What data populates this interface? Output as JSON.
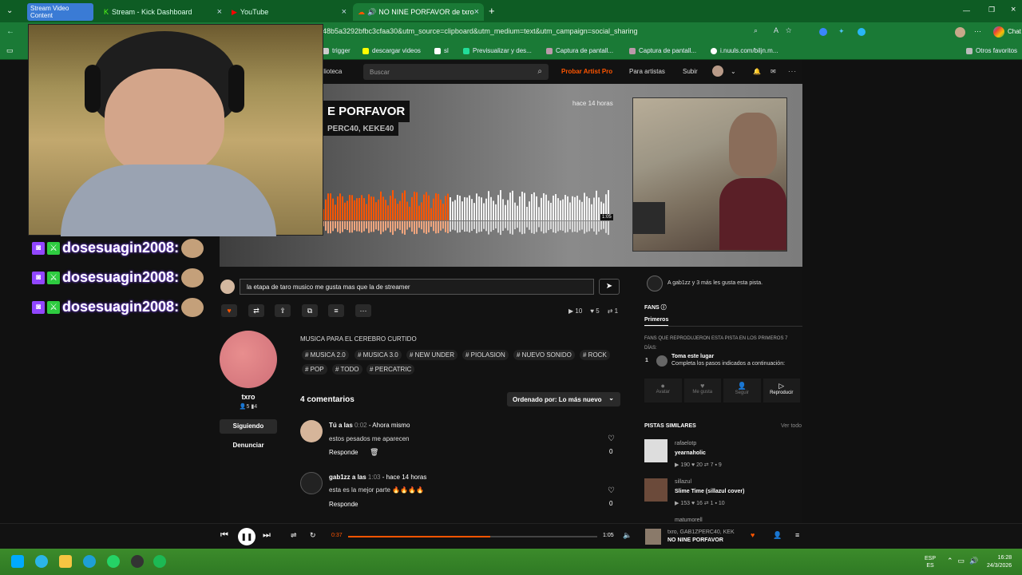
{
  "browser": {
    "tabs": [
      {
        "label": "Stream Video Content",
        "kind": "pill"
      },
      {
        "label": "Stream - Kick Dashboard"
      },
      {
        "label": "YouTube"
      },
      {
        "label": "NO NINE PORFAVOR de txro",
        "active": true
      }
    ],
    "url": "48b5a3292bfbc3cfaa30&utm_source=clipboard&utm_medium=text&utm_campaign=social_sharing",
    "bookmarks": [
      "trigger",
      "descargar videos",
      "sl",
      "Previsualizar y des...",
      "Captura de pantall...",
      "Captura de pantall...",
      "i.nuuls.com/biljn.m..."
    ],
    "other_bookmarks": "Otros favoritos",
    "profile_label": "Chat"
  },
  "header": {
    "library": "iblioteca",
    "search_placeholder": "Buscar",
    "try_pro": "Probar Artist Pro",
    "for_artists": "Para artistas",
    "upload": "Subir"
  },
  "hero": {
    "title": "E PORFAVOR",
    "artists": "PERC40, KEKE40",
    "time_ago": "hace 14 horas",
    "waveform_marker": "1:05"
  },
  "chat": {
    "lines": [
      "dosesuagin2008:",
      "dosesuagin2008:",
      "dosesuagin2008:"
    ]
  },
  "comment_input": {
    "value": "la etapa de taro musico me gusta mas que la de streamer"
  },
  "actions": {
    "plays": "10",
    "likes": "5",
    "reposts": "1"
  },
  "track": {
    "description": "MUSICA PARA EL CEREBRO CURTIDO",
    "tags": [
      "# MUSICA 2.0",
      "# MUSICA 3.0",
      "# NEW UNDER",
      "# PIOLASION",
      "# NUEVO SONIDO",
      "# ROCK",
      "# POP",
      "# TODO",
      "# PERCATRIC"
    ]
  },
  "uploader": {
    "name": "txro",
    "followers": "5",
    "tracks": "4",
    "following_label": "Siguiendo",
    "report_label": "Denunciar"
  },
  "comments": {
    "count_label": "4 comentarios",
    "sort_label": "Ordenado por: Lo más nuevo",
    "items": [
      {
        "author": "Tú a las",
        "time": "0:02",
        "ago": "- Ahora mismo",
        "text": "estos pesados me aparecen",
        "reply": "Responde",
        "likes": "0"
      },
      {
        "author": "gab1zz a las",
        "time": "1:03",
        "ago": "- hace 14 horas",
        "text": "esta es la mejor parte 🔥🔥🔥🔥",
        "reply": "Responde",
        "likes": "0"
      }
    ]
  },
  "sidebar": {
    "likes_text": "A gab1zz y 3 más les gusta esta pista.",
    "fans_label": "FANS",
    "first_tab": "Primeros",
    "fans_desc": "FANS QUE REPRODUJERON ESTA PISTA EN LOS PRIMEROS 7 DÍAS:",
    "rank": "1",
    "claim_title": "Toma este lugar",
    "claim_desc": "Completa los pasos indicados a continuación:",
    "steps": [
      "Avatar",
      "Me gusta",
      "Seguir",
      "Reproducir"
    ],
    "similar_label": "PISTAS SIMILARES",
    "see_all": "Ver todo",
    "similar": [
      {
        "artist": "rafaelotp",
        "title": "yearnaholic",
        "plays": "190",
        "likes": "20",
        "reposts": "7",
        "comments": "9"
      },
      {
        "artist": "sillazul",
        "title": "Slime Time (sillazul cover)",
        "plays": "153",
        "likes": "16",
        "reposts": "1",
        "comments": "10"
      },
      {
        "artist": "matumorell",
        "title": "",
        "plays": "",
        "likes": "",
        "reposts": "",
        "comments": ""
      }
    ]
  },
  "player": {
    "elapsed": "0:37",
    "total": "1:05",
    "progress": 0.57,
    "now_artist": "txro, GAB1ZPERC40, KEK",
    "now_title": "NO NINE PORFAVOR"
  },
  "taskbar": {
    "lang": "ESP",
    "lang2": "ES",
    "time": "16:28",
    "date": "24/3/2026"
  },
  "colors": {
    "accent": "#ff5500",
    "twitch": "#9146ff"
  }
}
